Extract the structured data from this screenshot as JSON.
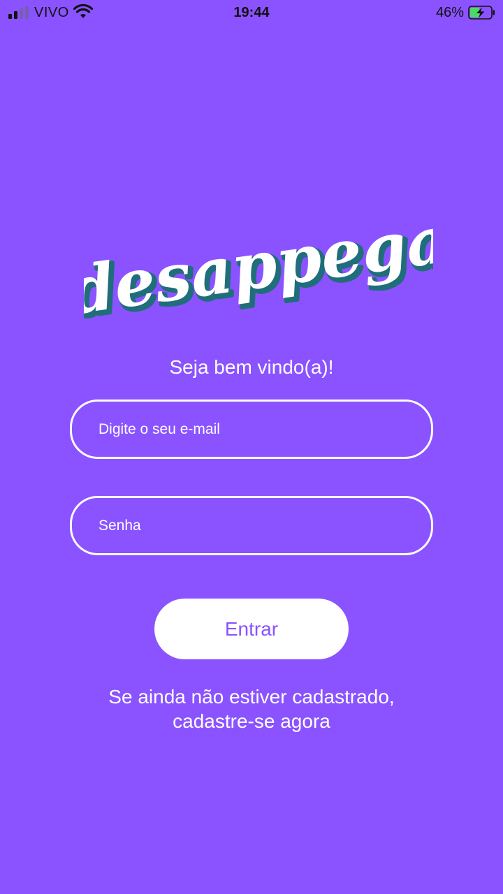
{
  "status_bar": {
    "carrier": "VIVO",
    "time": "19:44",
    "battery_percent": "46%",
    "battery_level": 0.46,
    "charging": true
  },
  "logo": {
    "text": "desappega"
  },
  "welcome_text": "Seja bem vindo(a)!",
  "email_field": {
    "placeholder": "Digite o seu e-mail",
    "value": ""
  },
  "password_field": {
    "placeholder": "Senha",
    "value": ""
  },
  "login_button": {
    "label": "Entrar"
  },
  "signup": {
    "line1": "Se ainda não estiver cadastrado,",
    "line2": "cadastre-se agora"
  },
  "colors": {
    "background": "#8a53ff",
    "logo_shadow": "#1f6e7a",
    "battery_charge": "#4cd964"
  }
}
